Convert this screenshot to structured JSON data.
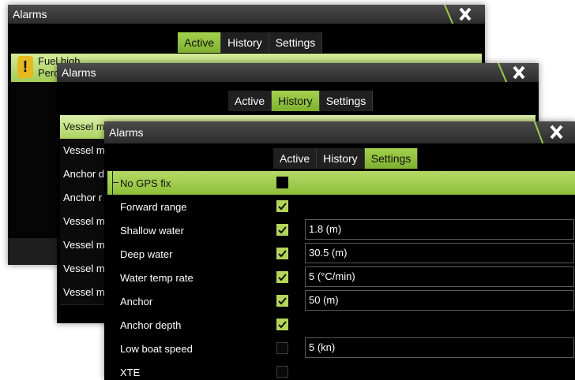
{
  "windows": {
    "alarms_active": {
      "title": "Alarms",
      "tabs": [
        "Active",
        "History",
        "Settings"
      ],
      "alarm": {
        "line1": "Fuel high",
        "line2": "Perce"
      }
    },
    "alarms_history": {
      "title": "Alarms",
      "tabs": [
        "Active",
        "History",
        "Settings"
      ],
      "rows": [
        "Vessel m",
        "Vessel m",
        "Anchor d",
        "Anchor r",
        "Vessel m",
        "Vessel m",
        "Vessel m",
        "Vessel m"
      ]
    },
    "alarms_settings": {
      "title": "Alarms",
      "tabs": [
        "Active",
        "History",
        "Settings"
      ],
      "rows": [
        {
          "label": "No GPS fix",
          "checked": false,
          "value": ""
        },
        {
          "label": "Forward range",
          "checked": true,
          "value": ""
        },
        {
          "label": "Shallow water",
          "checked": true,
          "value": "1.8 (m)"
        },
        {
          "label": "Deep water",
          "checked": true,
          "value": "30.5 (m)"
        },
        {
          "label": "Water temp rate",
          "checked": true,
          "value": "5 (°C/min)"
        },
        {
          "label": "Anchor",
          "checked": true,
          "value": "50 (m)"
        },
        {
          "label": "Anchor depth",
          "checked": true,
          "value": ""
        },
        {
          "label": "Low boat speed",
          "checked": false,
          "value": "5 (kn)"
        },
        {
          "label": "XTE",
          "checked": false,
          "value": ""
        }
      ]
    }
  },
  "colors": {
    "accent": "#9ccb48",
    "titlebar": "#3a3a3a",
    "warning": "#e5b91f"
  },
  "icons": {
    "close": "close-icon",
    "warning": "warning-icon",
    "check": "checkmark-icon"
  }
}
